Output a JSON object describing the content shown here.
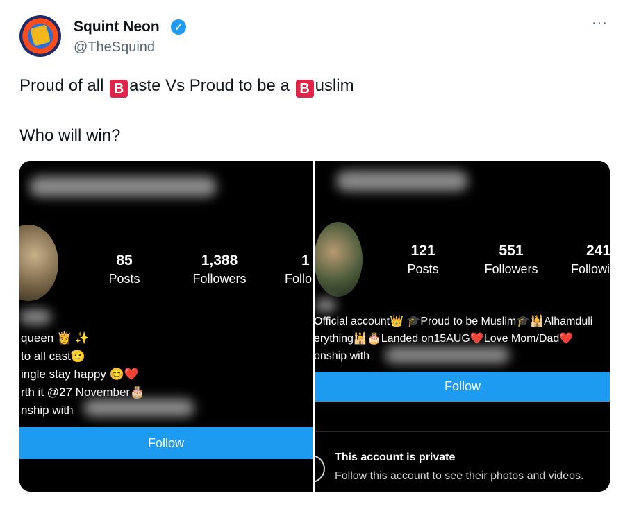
{
  "author": {
    "name": "Squint Neon",
    "handle": "@TheSquind",
    "verified_icon": "verified-badge-icon"
  },
  "menu_icon": "more-icon",
  "more_label": "···",
  "tweet_text": {
    "line1": {
      "part1": "Proud of all ",
      "emoji1": "B",
      "part2": "aste Vs Proud to be a ",
      "emoji2": "B",
      "part3": "uslim"
    },
    "line2": "Who will win?"
  },
  "left_profile": {
    "posts": "85",
    "posts_label": "Posts",
    "followers": "1,388",
    "followers_label": "Followers",
    "following_partial": "1",
    "following_label_partial": "Follo",
    "bio": [
      "queen 👸 ✨",
      "to all cast🫡",
      "ingle stay happy 😊❤️",
      "rth it @27 November🎂",
      "nship with"
    ],
    "follow_label": "Follow"
  },
  "right_profile": {
    "posts": "121",
    "posts_label": "Posts",
    "followers": "551",
    "followers_label": "Followers",
    "following_partial": "241",
    "following_label_partial": "Followi",
    "bio": [
      "Official account👑 🎓Proud to be Muslim🎓🕌Alhamduli",
      "erything🕌🎂Landed on15AUG❤️Love Mom/Dad❤️",
      "onship with"
    ],
    "follow_label": "Follow",
    "private_title": "This account is private",
    "private_sub": "Follow this account to see their photos and videos."
  },
  "colors": {
    "accent": "#1d9bf0",
    "emoji_bg": "#e0244a",
    "muted": "#536471"
  }
}
